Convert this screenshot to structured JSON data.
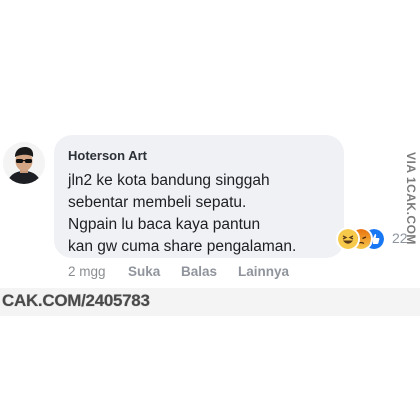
{
  "comment": {
    "author": "Hoterson Art",
    "text_lines": [
      "jln2 ke kota bandung singgah",
      "sebentar membeli sepatu.",
      "Ngpain lu baca kaya pantun",
      "kan gw cuma share pengalaman."
    ],
    "reactions": {
      "icons": [
        "haha-reaction-icon",
        "angry-reaction-icon",
        "like-reaction-icon"
      ],
      "count": "22"
    },
    "actions": {
      "time": "2 mgg",
      "like_label": "Suka",
      "reply_label": "Balas",
      "more_label": "Lainnya"
    }
  },
  "watermark": "CAK.COM/2405783",
  "side_credit": "VIA 1CAK.COM",
  "colors": {
    "bubble": "#f0f1f5",
    "haha": "#f7c94b",
    "angry": "#e9710f",
    "like": "#1877f2"
  }
}
